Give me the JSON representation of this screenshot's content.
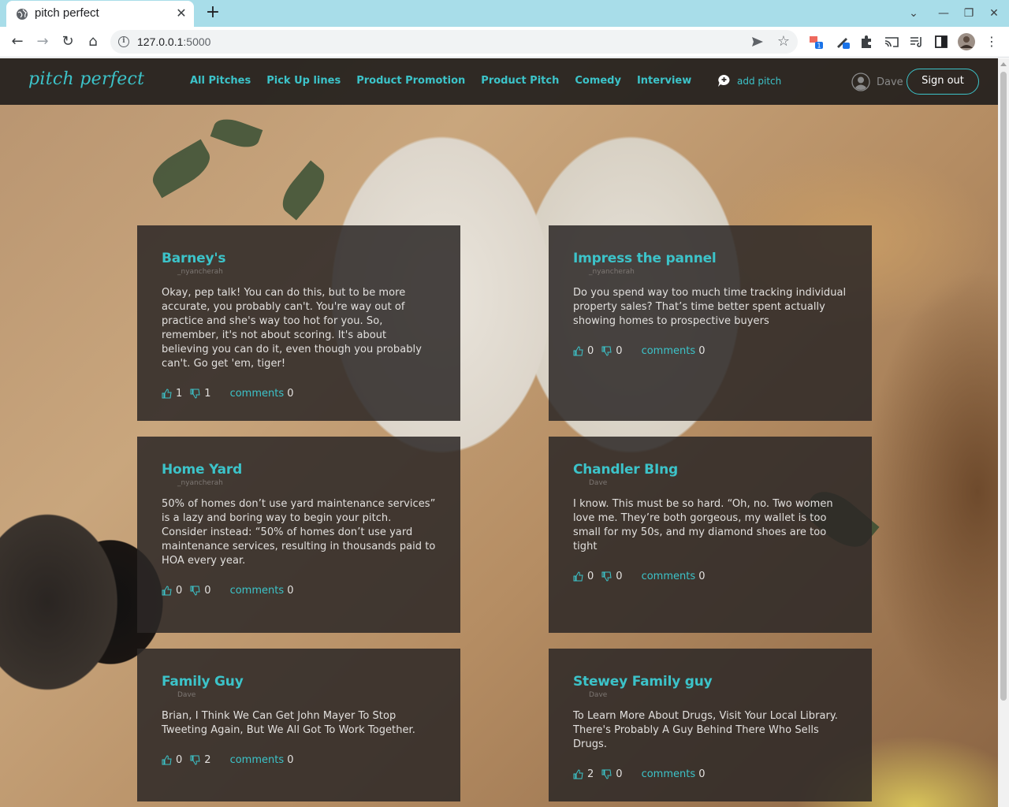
{
  "browser": {
    "tab_title": "pitch perfect",
    "url_host": "127.0.0.1",
    "url_port": ":5000",
    "extension_badge": "1"
  },
  "nav": {
    "brand": "pitch perfect",
    "links": [
      "All Pitches",
      "Pick Up lines",
      "Product Promotion",
      "Product Pitch",
      "Comedy",
      "Interview"
    ],
    "add_pitch": "add pitch",
    "username": "Dave",
    "sign_out": "Sign out"
  },
  "colors": {
    "accent": "#3cc3c9",
    "card_bg": "#2c2826",
    "tab_strip": "#a8dde9"
  },
  "pitches": [
    {
      "title": "Barney's",
      "author": "_nyancherah",
      "body": "Okay, pep talk! You can do this, but to be more accurate, you probably can't. You're way out of practice and she's way too hot for you. So, remember, it's not about scoring. It's about believing you can do it, even though you probably can't. Go get 'em, tiger!",
      "likes": "1",
      "dislikes": "1",
      "comments_label": "comments",
      "comments": "0"
    },
    {
      "title": "Impress the pannel",
      "author": "_nyancherah",
      "body": "Do you spend way too much time tracking individual property sales? That’s time better spent actually showing homes to prospective buyers",
      "likes": "0",
      "dislikes": "0",
      "comments_label": "comments",
      "comments": "0"
    },
    {
      "title": "Home Yard",
      "author": "_nyancherah",
      "body": "50% of homes don’t use yard maintenance services” is a lazy and boring way to begin your pitch. Consider instead: “50% of homes don’t use yard maintenance services, resulting in thousands paid to HOA every year.",
      "likes": "0",
      "dislikes": "0",
      "comments_label": "comments",
      "comments": "0"
    },
    {
      "title": "Chandler BIng",
      "author": "Dave",
      "body": "I know. This must be so hard. “Oh, no. Two women love me. They’re both gorgeous, my wallet is too small for my 50s, and my diamond shoes are too tight",
      "likes": "0",
      "dislikes": "0",
      "comments_label": "comments",
      "comments": "0"
    },
    {
      "title": "Family Guy",
      "author": "Dave",
      "body": "Brian, I Think We Can Get John Mayer To Stop Tweeting Again, But We All Got To Work Together.",
      "likes": "0",
      "dislikes": "2",
      "comments_label": "comments",
      "comments": "0"
    },
    {
      "title": "Stewey Family guy",
      "author": "Dave",
      "body": "To Learn More About Drugs, Visit Your Local Library. There's Probably A Guy Behind There Who Sells Drugs.",
      "likes": "2",
      "dislikes": "0",
      "comments_label": "comments",
      "comments": "0"
    }
  ]
}
